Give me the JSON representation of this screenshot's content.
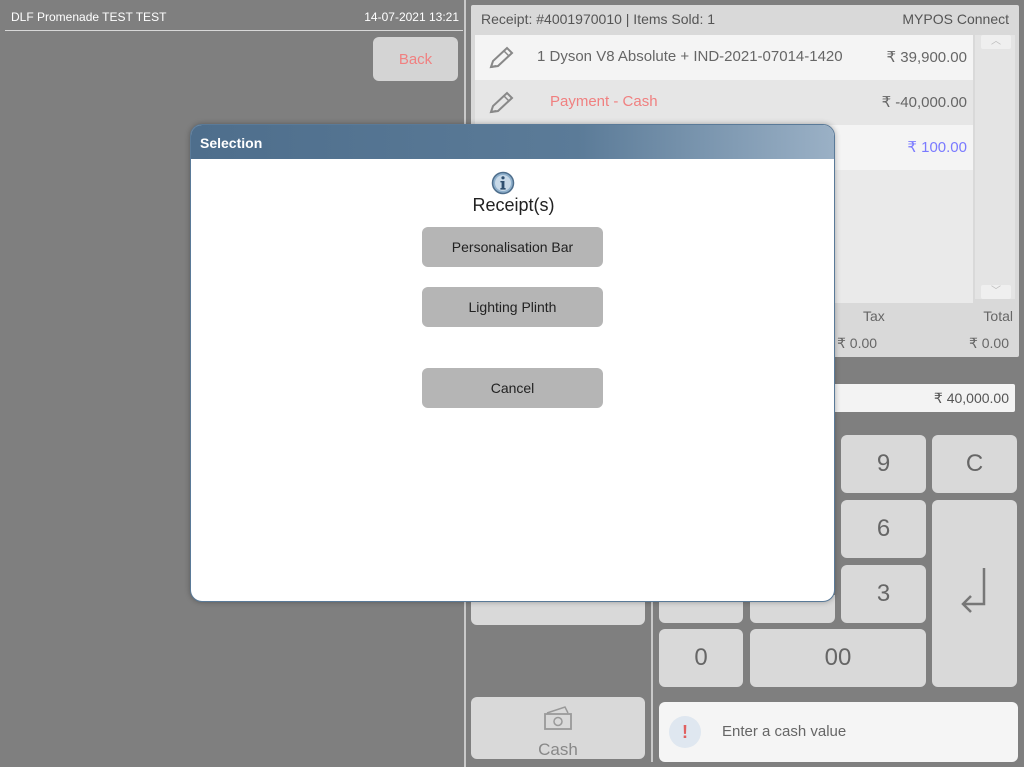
{
  "header": {
    "store": "DLF Promenade TEST TEST",
    "datetime": "14-07-2021 13:21",
    "back_label": "Back"
  },
  "receipt": {
    "title": "Receipt: #4001970010 | Items Sold: 1",
    "connect": "MYPOS Connect",
    "lines": [
      {
        "description": "1 Dyson V8 Absolute +   IND-2021-07014-1420",
        "amount": "₹ 39,900.00"
      },
      {
        "description": "Payment - Cash",
        "amount": "₹ -40,000.00"
      },
      {
        "description": "",
        "amount": "₹ 100.00"
      }
    ],
    "tax_label": "Tax",
    "total_label": "Total",
    "tax_value": "₹ 0.00",
    "total_value": "₹ 0.00"
  },
  "keypad": {
    "amount": "₹ 40,000.00",
    "keys": {
      "nine": "9",
      "clear": "C",
      "six": "6",
      "three": "3",
      "zero": "0",
      "double_zero": "00",
      "enter": "↲"
    },
    "cash_label": "Cash",
    "hint": "Enter a cash value"
  },
  "modal": {
    "title": "Selection",
    "heading": "Receipt(s)",
    "options": [
      "Personalisation Bar",
      "Lighting Plinth"
    ],
    "cancel_label": "Cancel"
  },
  "colors": {
    "accent_red": "#f08080",
    "change_blue": "#7a7aff",
    "modal_header": "#4e6e8c"
  }
}
